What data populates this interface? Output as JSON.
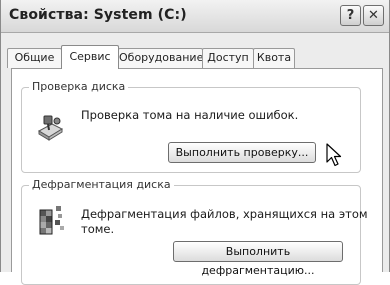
{
  "window": {
    "title": "Свойства: System (C:)",
    "help_glyph": "?",
    "close_glyph": "✕"
  },
  "tabs": [
    {
      "label": "Общие",
      "active": false
    },
    {
      "label": "Сервис",
      "active": true
    },
    {
      "label": "Оборудование",
      "active": false
    },
    {
      "label": "Доступ",
      "active": false
    },
    {
      "label": "Квота",
      "active": false
    }
  ],
  "disk_check": {
    "legend": "Проверка диска",
    "description": "Проверка тома на наличие ошибок.",
    "button_label": "Выполнить проверку...",
    "icon": "disk-check-icon"
  },
  "defrag": {
    "legend": "Дефрагментация диска",
    "description_line1": "Дефрагментация файлов, хранящихся на этом",
    "description_line2": "томе.",
    "button_label": "Выполнить дефрагментацию...",
    "icon": "defrag-icon"
  },
  "cursor": "mouse-pointer-icon"
}
